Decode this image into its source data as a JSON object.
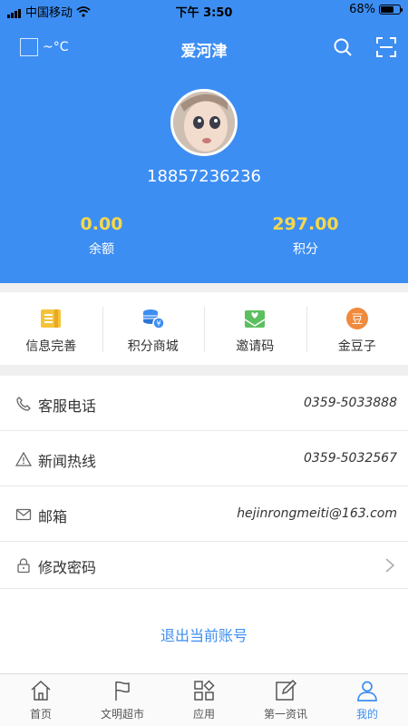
{
  "status_bar": {
    "carrier": "中国移动",
    "time": "下午 3:50",
    "battery": "68%",
    "battery_level": 0.68
  },
  "header": {
    "weather": "~°C",
    "title": "爱河津",
    "search_icon": "search-icon",
    "scan_icon": "scan-icon"
  },
  "profile": {
    "phone": "18857236236",
    "balance_value": "0.00",
    "balance_label": "余额",
    "points_value": "297.00",
    "points_label": "积分"
  },
  "quick_menu": [
    {
      "label": "信息完善",
      "icon": "profile-card-icon",
      "color": "#f5c33b"
    },
    {
      "label": "积分商城",
      "icon": "coins-icon",
      "color": "#3d8ef2"
    },
    {
      "label": "邀请码",
      "icon": "invite-envelope-icon",
      "color": "#5cbf5f"
    },
    {
      "label": "金豆子",
      "icon": "bean-icon",
      "color": "#f08a3c"
    }
  ],
  "info_list": [
    {
      "label": "客服电话",
      "value": "0359-5033888",
      "icon": "phone-icon"
    },
    {
      "label": "新闻热线",
      "value": "0359-5032567",
      "icon": "warning-icon"
    },
    {
      "label": "邮箱",
      "value": "hejinrongmeiti@163.com",
      "icon": "mail-icon"
    },
    {
      "label": "修改密码",
      "value": "",
      "icon": "lock-icon"
    }
  ],
  "logout_label": "退出当前账号",
  "tabs": [
    {
      "label": "首页",
      "icon": "home-icon"
    },
    {
      "label": "文明超市",
      "icon": "flag-icon"
    },
    {
      "label": "应用",
      "icon": "apps-icon"
    },
    {
      "label": "第一资讯",
      "icon": "news-edit-icon"
    },
    {
      "label": "我的",
      "icon": "user-icon",
      "active": true
    }
  ],
  "colors": {
    "primary": "#3d8ef2",
    "stat_value": "#f6d84b"
  }
}
